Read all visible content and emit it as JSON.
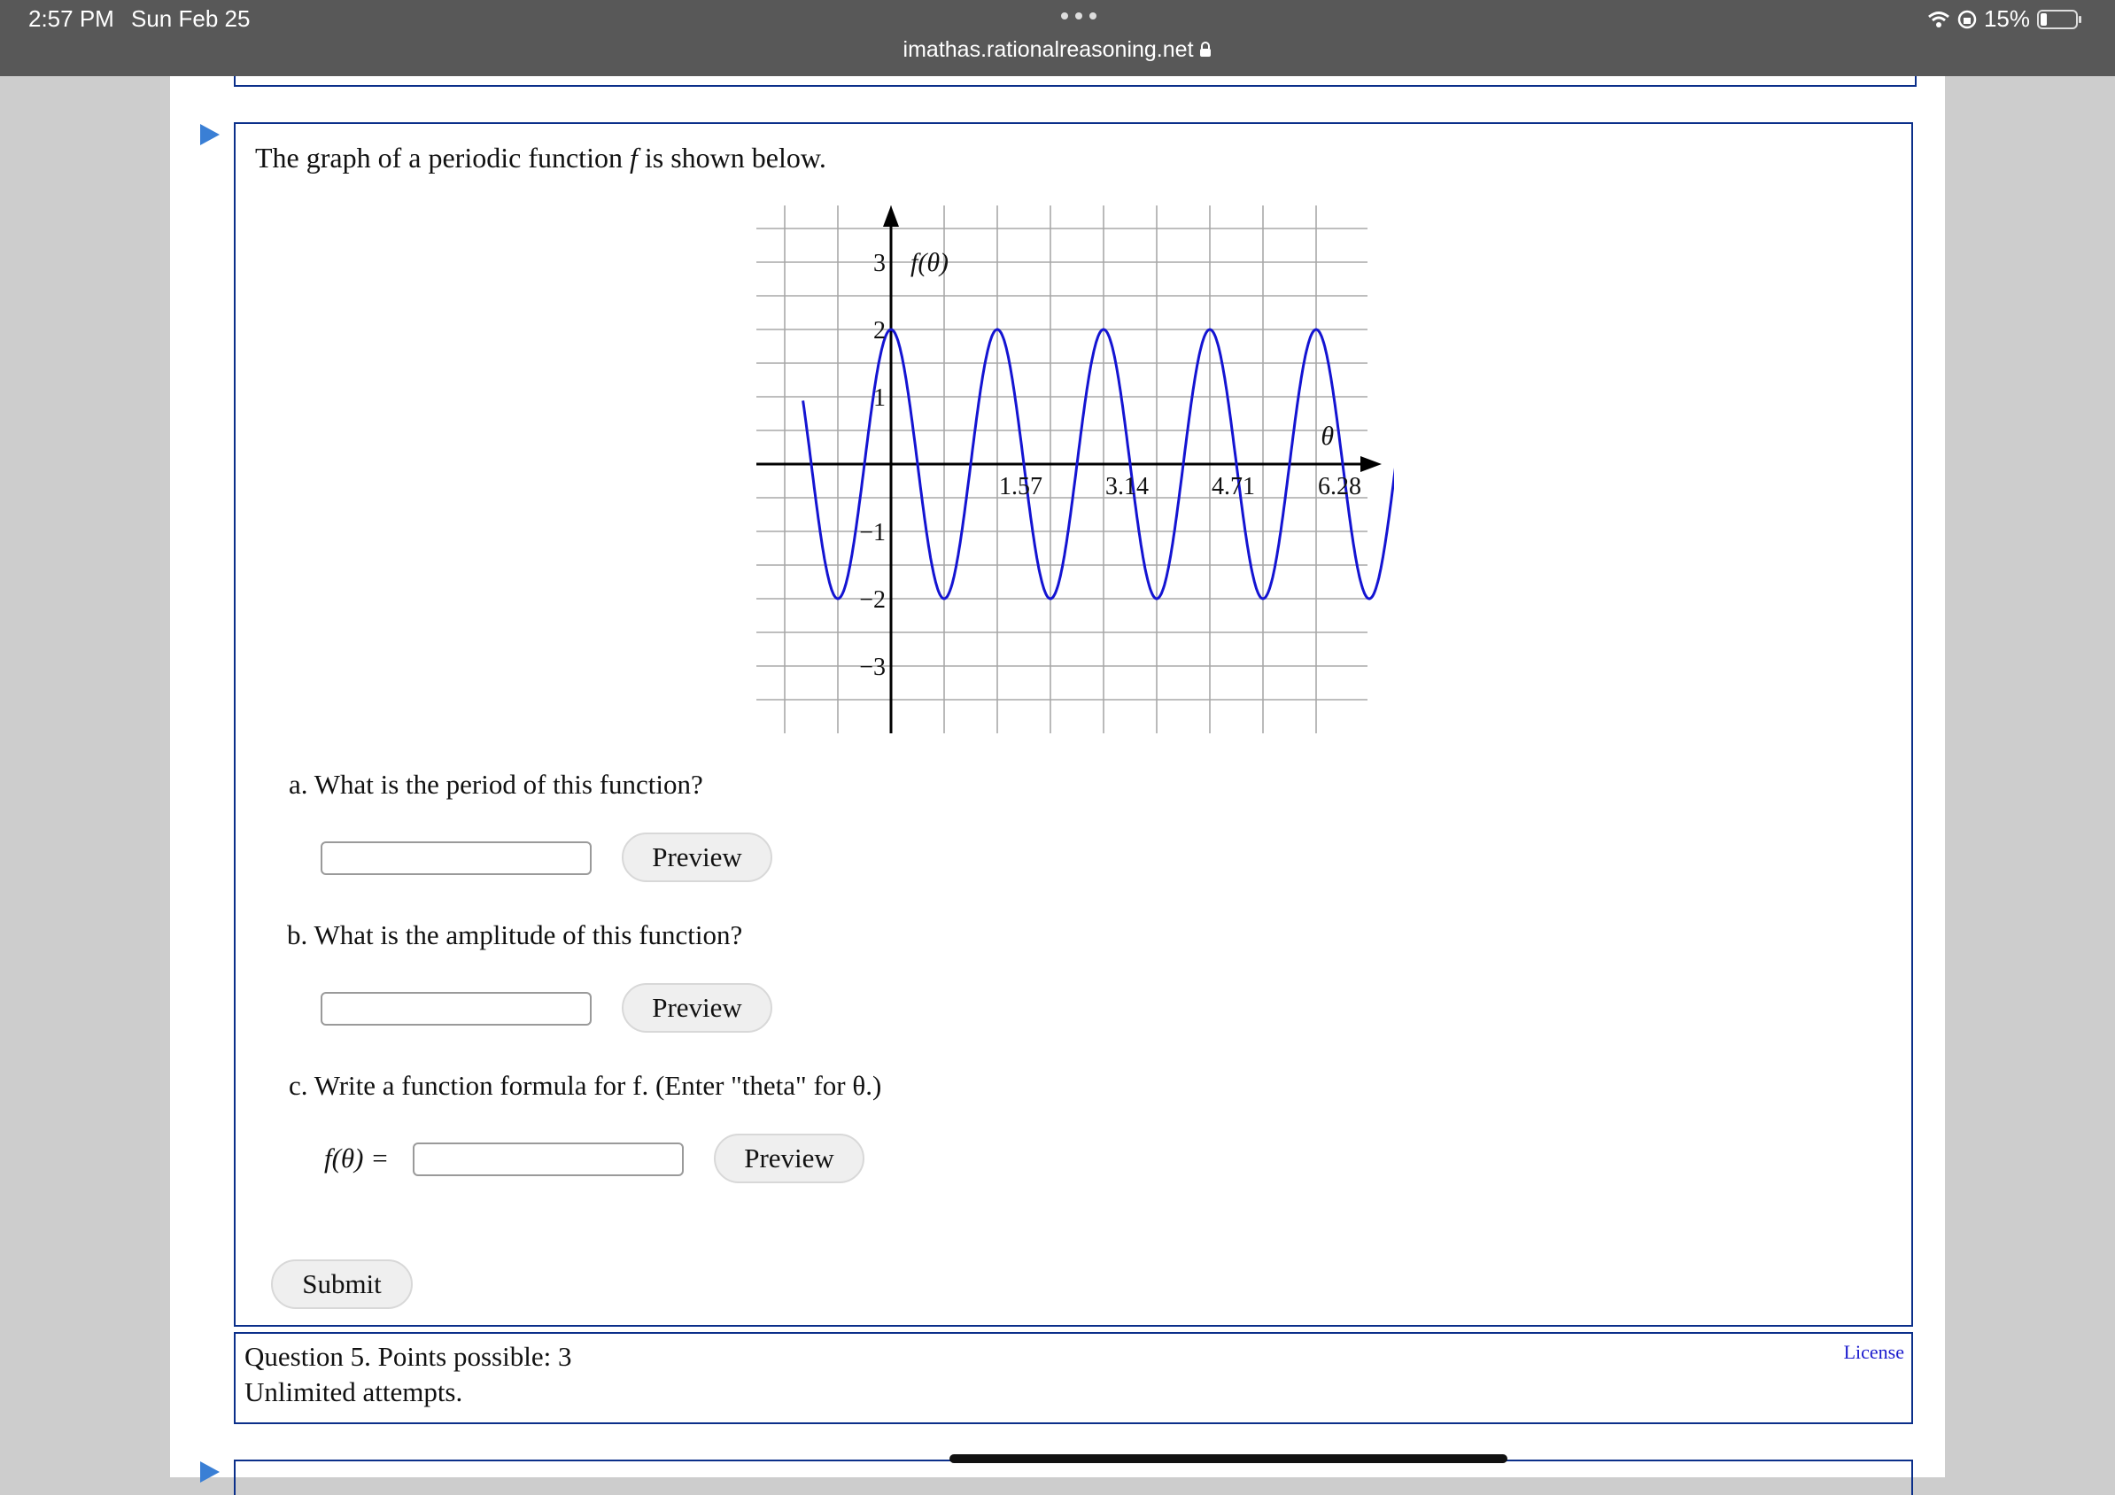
{
  "status_bar": {
    "time": "2:57 PM",
    "date": "Sun Feb 25",
    "url": "imathas.rationalreasoning.net",
    "battery": "15%"
  },
  "question": {
    "prompt_pre": "The graph of a periodic function ",
    "prompt_var": "f",
    "prompt_post": " is shown below.",
    "part_a": "a.  What is the period of this function?",
    "part_b": "b.  What is the amplitude of this function?",
    "part_c": "c.  Write a function formula for f. (Enter \"theta\" for θ.)",
    "formula_label": "f(θ) =",
    "preview_label": "Preview",
    "submit_label": "Submit"
  },
  "info": {
    "points": "Question 5. Points possible: 3",
    "attempts": "Unlimited attempts.",
    "license": "License"
  },
  "chart_data": {
    "type": "line",
    "ylabel": "f(θ)",
    "xlabel": "θ",
    "x_tick_labels": [
      "1.57",
      "3.14",
      "4.71",
      "6.28"
    ],
    "x_tick_values": [
      1.57,
      3.14,
      4.71,
      6.28
    ],
    "y_tick_labels": [
      "3",
      "2",
      "1",
      "−1",
      "−2",
      "−3"
    ],
    "y_tick_values": [
      3,
      2,
      1,
      -1,
      -2,
      -3
    ],
    "xlim": [
      -1.3,
      7.8
    ],
    "ylim": [
      -3.9,
      3.9
    ],
    "grid": true,
    "series": [
      {
        "function": "2cos(4θ)",
        "amplitude": 2,
        "period": 1.57,
        "color": "#1414d2"
      }
    ]
  }
}
